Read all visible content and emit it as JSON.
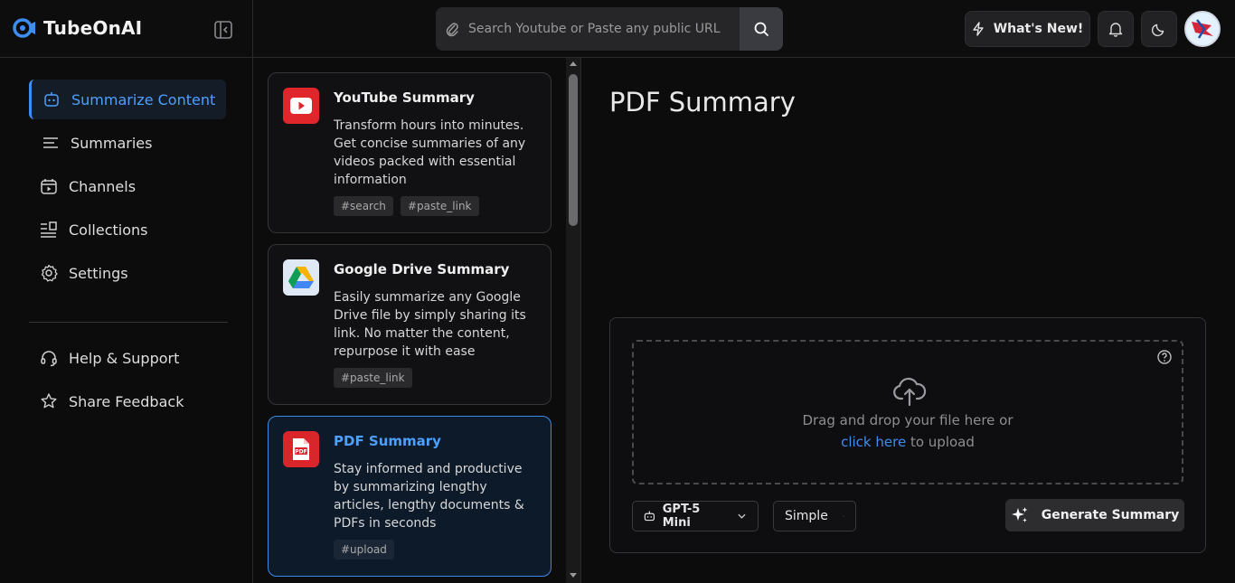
{
  "brand": {
    "name": "TubeOnAI"
  },
  "search": {
    "placeholder": "Search Youtube or Paste any public URL"
  },
  "header": {
    "whats_new": "What's New!"
  },
  "sidebar": {
    "items": [
      {
        "label": "Summarize Content",
        "icon": "bot-icon"
      },
      {
        "label": "Summaries",
        "icon": "list-icon"
      },
      {
        "label": "Channels",
        "icon": "calendar-icon"
      },
      {
        "label": "Collections",
        "icon": "collections-icon"
      },
      {
        "label": "Settings",
        "icon": "gear-icon"
      }
    ],
    "footer_items": [
      {
        "label": "Help & Support",
        "icon": "headset-icon"
      },
      {
        "label": "Share Feedback",
        "icon": "star-icon"
      }
    ]
  },
  "cards": [
    {
      "title": "YouTube Summary",
      "description": "Transform hours into minutes. Get concise summaries of any videos packed with essential information",
      "tags": [
        "#search",
        "#paste_link"
      ]
    },
    {
      "title": "Google Drive Summary",
      "description": "Easily summarize any Google Drive file by simply sharing its link. No matter the content, repurpose it with ease",
      "tags": [
        "#paste_link"
      ]
    },
    {
      "title": "PDF Summary",
      "description": "Stay informed and productive by summarizing lengthy articles, lengthy documents & PDFs in seconds",
      "tags": [
        "#upload"
      ]
    }
  ],
  "main": {
    "title": "PDF Summary",
    "drop_text": "Drag and drop your file here or",
    "click_here": "click here",
    "to_upload": "to upload",
    "model": "GPT-5 Mini",
    "mode": "Simple",
    "generate": "Generate Summary"
  },
  "colors": {
    "accent": "#3d8ef0",
    "background": "#0c0c0d",
    "youtube_red": "#e0262b",
    "pdf_red": "#d9262b"
  }
}
